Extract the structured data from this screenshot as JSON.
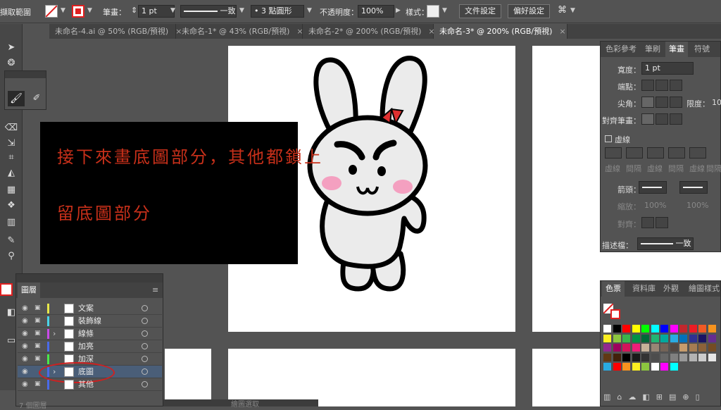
{
  "control_bar": {
    "left_label": "擷取範圍",
    "stroke_label": "筆畫：",
    "stroke_value": "1 pt",
    "profile_label": "一致",
    "brush_value": "3 點圓形",
    "opacity_label": "不透明度：",
    "opacity_value": "100%",
    "style_label": "樣式：",
    "doc_setup_button": "文件設定",
    "prefs_button": "偏好設定"
  },
  "tabs": [
    {
      "label": "未命名-4.ai @ 50% (RGB/預視)",
      "close": "×"
    },
    {
      "label": "未命名-1* @ 43% (RGB/預視)",
      "close": "×"
    },
    {
      "label": "未命名-2* @ 200% (RGB/預視)",
      "close": "×"
    },
    {
      "label": "未命名-3* @ 200% (RGB/預視)",
      "close": "×"
    }
  ],
  "overlay_caption": {
    "line1": "接下來畫底圖部分，其他都鎖上",
    "line2": "留底圖部分"
  },
  "stroke_panel": {
    "tabs": [
      "色彩參考",
      "筆刷",
      "筆畫",
      "符號"
    ],
    "width_label": "寬度：",
    "width_value": "1 pt",
    "cap_label": "端點：",
    "corner_label": "尖角：",
    "limit_label": "限度：",
    "limit_value": "10",
    "align_label": "對齊筆畫：",
    "dashed_label": "虛線",
    "dash_labels": [
      "虛線",
      "間隔",
      "虛線",
      "間隔",
      "虛線",
      "間隔"
    ],
    "arrow_label": "箭頭：",
    "scale_label": "縮放：",
    "scale_values": [
      "100%",
      "100%"
    ],
    "align_arrow_label": "對齊：",
    "profile_label": "描述檔：",
    "profile_value": "一致"
  },
  "swatches_panel": {
    "tabs": [
      "色票",
      "資料庫",
      "外觀",
      "繪圖樣式"
    ],
    "colors_row1": [
      "#ffffff",
      "#000000",
      "#ff0000",
      "#ffff00",
      "#00ff00",
      "#00ffff",
      "#0000ff",
      "#ff00ff",
      "#c1272d",
      "#ed1c24",
      "#f15a24",
      "#f7931e"
    ],
    "colors_row2": [
      "#fcee21",
      "#8cc63f",
      "#39b54a",
      "#009245",
      "#006837",
      "#22b573",
      "#00a99d",
      "#29abe2",
      "#0071bc",
      "#2e3192",
      "#1b1464",
      "#662d91"
    ],
    "colors_row3": [
      "#93278f",
      "#9e005d",
      "#d4145a",
      "#ed1e79",
      "#c7b299",
      "#998675",
      "#736357",
      "#534741",
      "#c69c6d",
      "#a67c52",
      "#8c6239",
      "#754c24"
    ],
    "colors_row4": [
      "#603813",
      "#42210b",
      "#000000",
      "#1a1a1a",
      "#333333",
      "#4d4d4d",
      "#666666",
      "#808080",
      "#999999",
      "#b3b3b3",
      "#cccccc",
      "#e6e6e6"
    ],
    "colors_row5": [
      "#29abe2",
      "#ff0000",
      "#f7931e",
      "#fcee21",
      "#8cc63f",
      "#ffffff",
      "#ff00ff",
      "#00ffff"
    ]
  },
  "layers_panel": {
    "title": "圖層",
    "layers": [
      {
        "name": "文案",
        "color": "#e8e84a"
      },
      {
        "name": "裝飾線",
        "color": "#4ad4e8"
      },
      {
        "name": "線條",
        "color": "#c84ae8"
      },
      {
        "name": "加亮",
        "color": "#4a6ae8"
      },
      {
        "name": "加深",
        "color": "#4ae84a"
      },
      {
        "name": "底圖",
        "color": "#4a6ae8"
      },
      {
        "name": "其他",
        "color": "#4a6ae8"
      }
    ],
    "footer": "7 個圖層"
  },
  "bottom_status": "繪圖選取"
}
